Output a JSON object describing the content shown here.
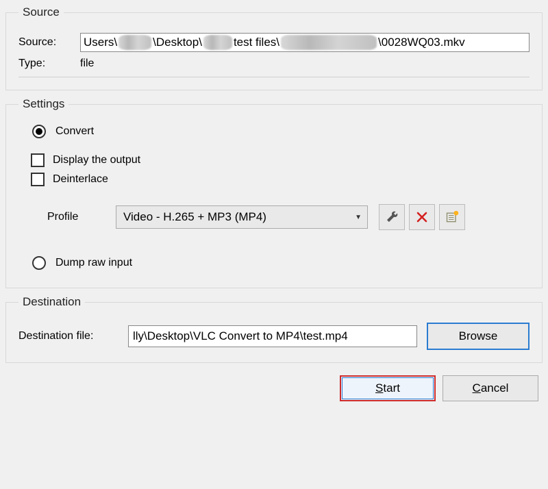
{
  "source": {
    "legend": "Source",
    "source_label": "Source:",
    "path_seg1": "Users\\",
    "path_seg2": "\\Desktop\\",
    "path_seg3": "test files\\",
    "path_seg4": "\\0028WQ03.mkv",
    "type_label": "Type:",
    "type_value": "file"
  },
  "settings": {
    "legend": "Settings",
    "convert_label": "Convert",
    "display_output_label": "Display the output",
    "deinterlace_label": "Deinterlace",
    "profile_label": "Profile",
    "profile_value": "Video - H.265 + MP3 (MP4)",
    "dump_raw_label": "Dump raw input"
  },
  "destination": {
    "legend": "Destination",
    "dest_label": "Destination file:",
    "dest_value": "lly\\Desktop\\VLC Convert to MP4\\test.mp4",
    "browse_label": "Browse"
  },
  "buttons": {
    "start": "Start",
    "cancel": "Cancel"
  }
}
